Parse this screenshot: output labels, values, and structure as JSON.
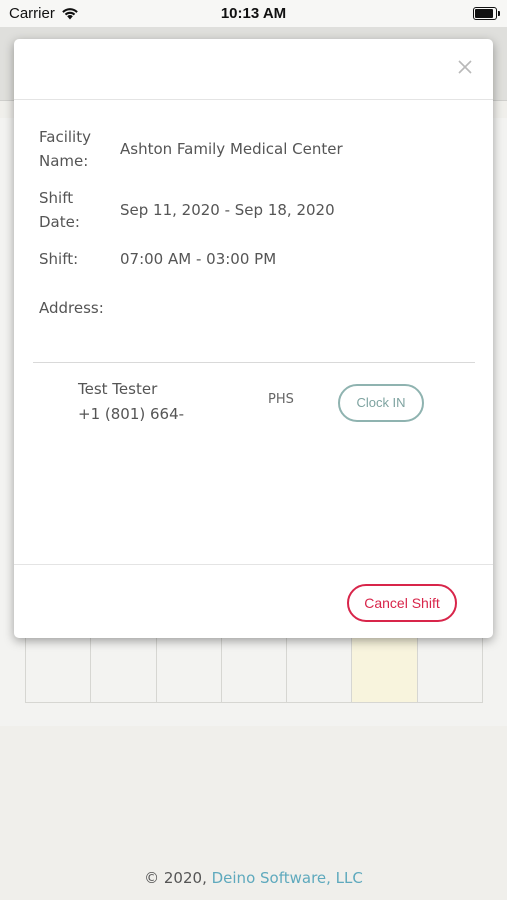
{
  "status_bar": {
    "carrier": "Carrier",
    "time": "10:13 AM",
    "icons": [
      "wifi-icon",
      "battery-icon"
    ],
    "battery_level": 0.95
  },
  "modal": {
    "close_icon": "close-icon",
    "fields": [
      {
        "label": "Facility Name:",
        "value": "Ashton Family Medical Center"
      },
      {
        "label": "Shift Date:",
        "value": "Sep 11, 2020 - Sep 18, 2020"
      },
      {
        "label": "Shift:",
        "value": "07:00 AM - 03:00 PM"
      },
      {
        "label": "Address:",
        "value": ""
      }
    ],
    "staff": {
      "name": "Test Tester",
      "phone": "+1 (801) 664-",
      "tag": "PHS",
      "clock_in_label": "Clock IN"
    },
    "cancel_label": "Cancel Shift"
  },
  "footer": {
    "copyright": "© 2020, ",
    "company": "Deino Software, LLC"
  },
  "colors": {
    "accent_teal": "#8fb3b0",
    "danger": "#d8254a",
    "link": "#5ea9bd",
    "today_highlight": "#f8f4dd"
  }
}
